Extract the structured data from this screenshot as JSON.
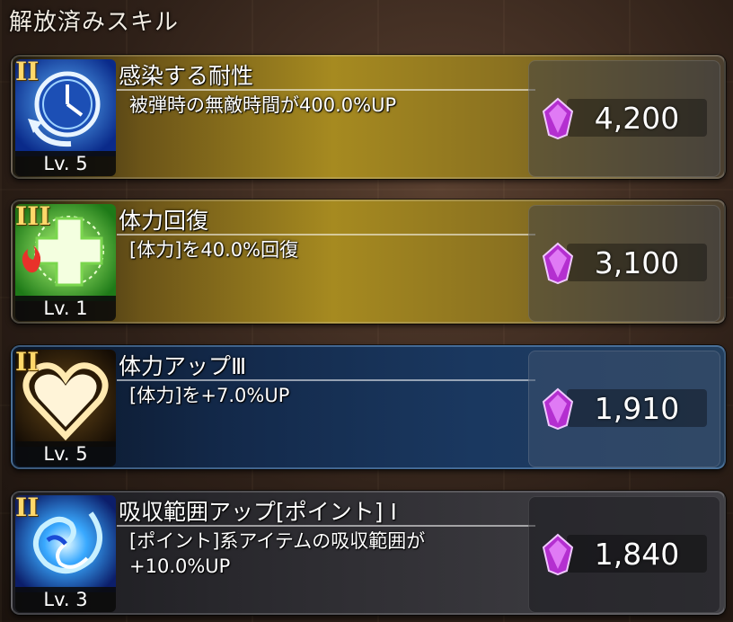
{
  "header": {
    "title": "解放済みスキル"
  },
  "skills": [
    {
      "rank": "II",
      "name": "感染する耐性",
      "description": "被弾時の無敵時間が400.0%UP",
      "level": "Lv. 5",
      "cost": "4,200",
      "icon": "clock-icon",
      "style": "gold"
    },
    {
      "rank": "III",
      "name": "体力回復",
      "description": "[体力]を40.0%回復",
      "level": "Lv. 1",
      "cost": "3,100",
      "icon": "heal-cross-icon",
      "style": "gold"
    },
    {
      "rank": "II",
      "name": "体力アップⅢ",
      "description": "[体力]を+7.0%UP",
      "level": "Lv. 5",
      "cost": "1,910",
      "icon": "heart-icon",
      "style": "blue"
    },
    {
      "rank": "II",
      "name": "吸収範囲アップ[ポイント] Ⅰ",
      "description": "[ポイント]系アイテムの吸収範囲が+10.0%UP",
      "level": "Lv. 3",
      "cost": "1,840",
      "icon": "vortex-icon",
      "style": "gray"
    }
  ],
  "colors": {
    "gold": "#a68a20",
    "blue": "#1a3860",
    "gem": "#c13cd8",
    "rank": "#ffd86a"
  }
}
